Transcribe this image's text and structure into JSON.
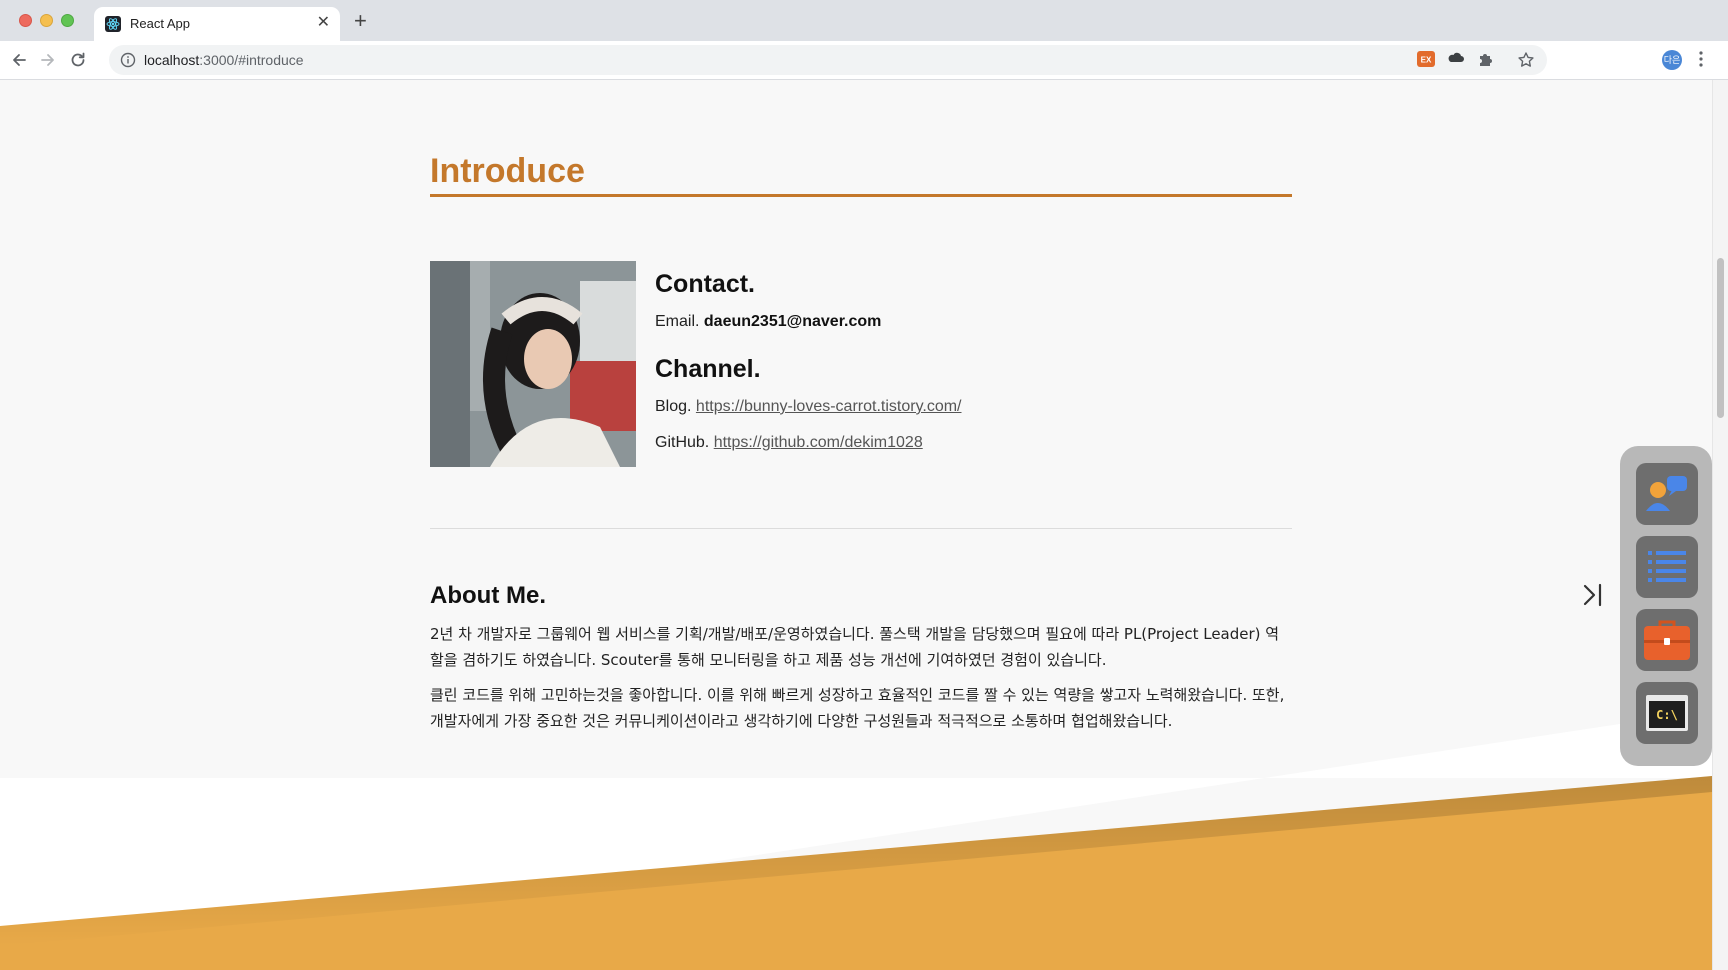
{
  "browser": {
    "tab_title": "React App",
    "url_host": "localhost",
    "url_path": ":3000/#introduce",
    "profile_initials": "다은",
    "ext_ex_label": "EX"
  },
  "introduce": {
    "title": "Introduce",
    "contact_heading": "Contact.",
    "email_label": "Email.",
    "email_value": "daeun2351@naver.com",
    "channel_heading": "Channel.",
    "blog_label": "Blog.",
    "blog_url": "https://bunny-loves-carrot.tistory.com/",
    "github_label": "GitHub.",
    "github_url": "https://github.com/dekim1028"
  },
  "about": {
    "heading": "About Me.",
    "paragraphs": [
      "2년 차 개발자로 그룹웨어 웹 서비스를 기획/개발/배포/운영하였습니다. 풀스택 개발을 담당했으며 필요에 따라 PL(Project Leader) 역할을 겸하기도 하였습니다. Scouter를 통해 모니터링을 하고 제품 성능 개선에 기여하였던 경험이 있습니다.",
      "클린 코드를 위해 고민하는것을 좋아합니다. 이를 위해 빠르게 성장하고 효율적인 코드를 짤 수 있는 역량을 쌓고자 노력해왔습니다. 또한, 개발자에게 가장 중요한 것은 커뮤니케이션이라고 생각하기에 다양한 구성원들과 적극적으로 소통하며 협업해왔습니다."
    ]
  },
  "dock": {
    "items": [
      "contact-icon",
      "list-icon",
      "briefcase-icon",
      "terminal-icon"
    ],
    "terminal_label": "C:\\"
  },
  "colors": {
    "accent": "#c4782b",
    "band": "#e8a948"
  }
}
